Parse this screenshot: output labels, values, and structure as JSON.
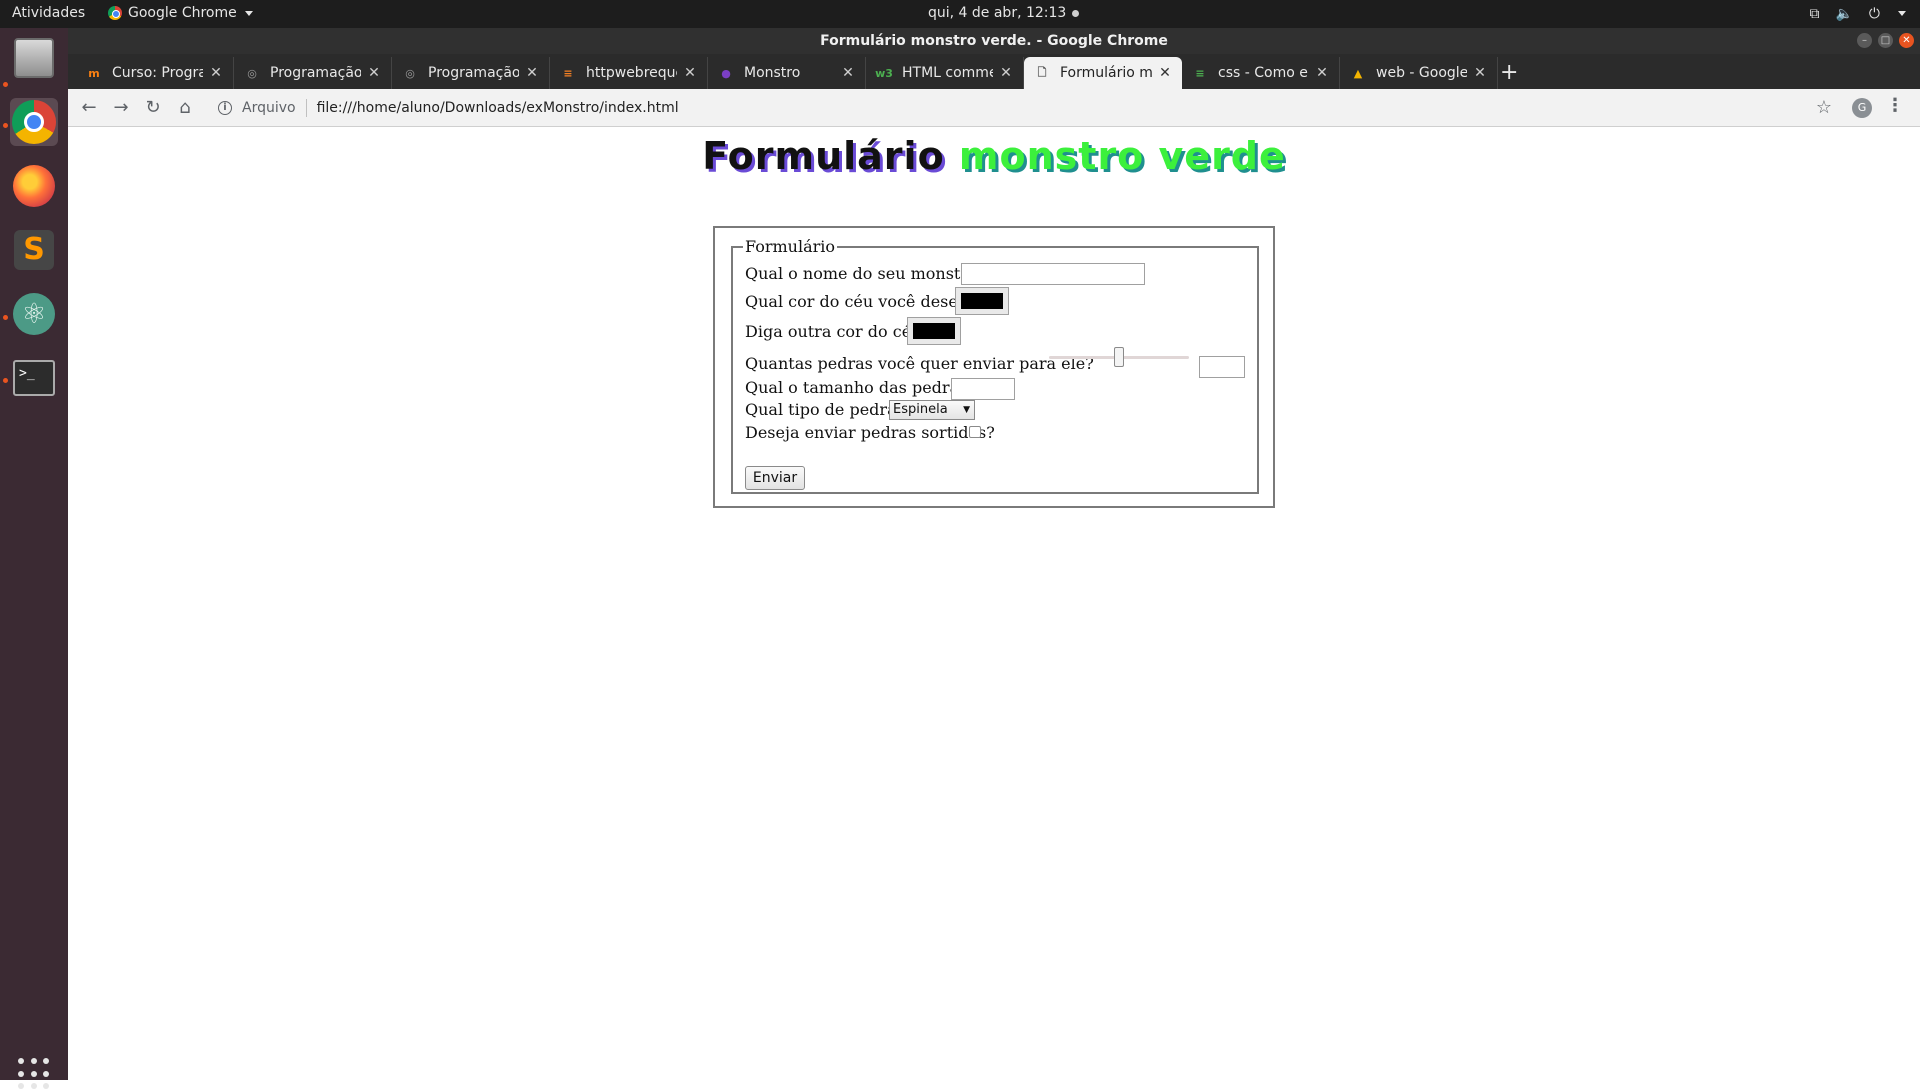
{
  "system_bar": {
    "activities": "Atividades",
    "app_name": "Google Chrome",
    "clock": "qui,  4 de abr, 12:13"
  },
  "window": {
    "title": "Formulário monstro verde. - Google Chrome"
  },
  "tabs": [
    {
      "label": "Curso: Programação",
      "favicon": "moodle-icon",
      "favicon_text": "m",
      "favicon_color": "#f98012"
    },
    {
      "label": "Programação Web",
      "favicon": "globe-icon",
      "favicon_text": "◎",
      "favicon_color": "#9e9e9e"
    },
    {
      "label": "Programação Web",
      "favicon": "globe-icon",
      "favicon_text": "◎",
      "favicon_color": "#9e9e9e"
    },
    {
      "label": "httpwebrequest - V",
      "favicon": "stackoverflow-icon",
      "favicon_text": "≡",
      "favicon_color": "#f48024"
    },
    {
      "label": "Monstro",
      "favicon": "monster-icon",
      "favicon_text": "●",
      "favicon_color": "#7b3fc4"
    },
    {
      "label": "HTML comment tag",
      "favicon": "w3-icon",
      "favicon_text": "w3",
      "favicon_color": "#4caf50"
    },
    {
      "label": "Formulário monstro verde.",
      "favicon": "file-icon",
      "favicon_text": "🗋",
      "favicon_color": "#555555",
      "active": true
    },
    {
      "label": "css - Como eu cons",
      "favicon": "stackoverflow-icon",
      "favicon_text": "≡",
      "favicon_color": "#4caf50"
    },
    {
      "label": "web - Google Drive",
      "favicon": "google-drive-icon",
      "favicon_text": "▲",
      "favicon_color": "#f4b400"
    }
  ],
  "toolbar": {
    "security_label": "Arquivo",
    "url": "file:///home/aluno/Downloads/exMonstro/index.html",
    "profile_initial": "G"
  },
  "page": {
    "heading_part1": "Formulário",
    "heading_part2": "monstro verde",
    "form": {
      "legend": "Formulário",
      "q_name": "Qual o nome do seu monstro?",
      "name_value": "",
      "q_sky_color": "Qual cor do céu você deseja?",
      "sky_color_value": "#000000",
      "q_other_color": "Diga outra cor do céu:",
      "other_color_value": "#000000",
      "q_stones_count": "Quantas pedras você quer enviar para ele?",
      "stones_range_level": 0.5,
      "stones_count_value": "",
      "q_stone_size": "Qual o tamanho das pedras?",
      "stone_size_value": "",
      "q_stone_type": "Qual tipo de pedra?",
      "stone_type_selected": "Espinela",
      "q_assorted": "Deseja enviar pedras sortidas?",
      "assorted_checked": false,
      "submit_label": "Enviar"
    }
  },
  "colors": {
    "heading_dark": "#111111",
    "heading_green": "#3cf03c",
    "ubuntu_orange": "#e95420"
  }
}
